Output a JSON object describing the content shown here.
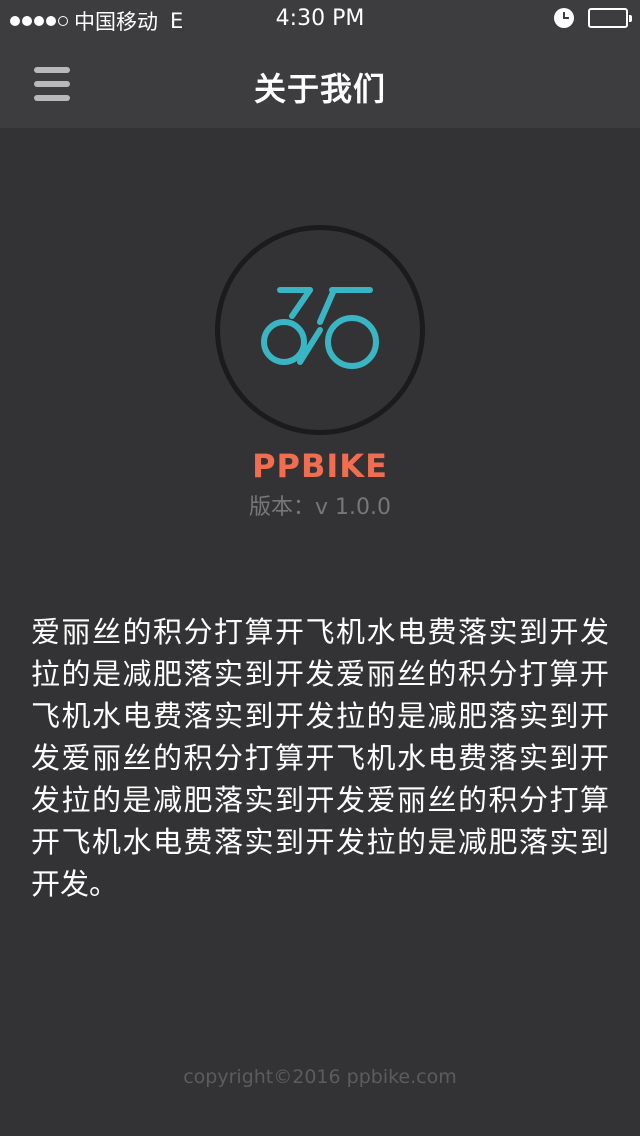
{
  "status_bar": {
    "carrier": "中国移动",
    "network": "E",
    "time": "4:30 PM",
    "signal_strength": "4/5",
    "alarm_icon": "clock-icon",
    "battery_icon": "battery-full-icon"
  },
  "nav": {
    "title": "关于我们",
    "menu_icon": "hamburger-menu-icon"
  },
  "app": {
    "logo_icon": "bicycle-logo-icon",
    "name": "PPBIKE",
    "version_label": "版本：",
    "version_value": "v 1.0.0"
  },
  "description": "爱丽丝的积分打算开飞机水电费落实到开发拉的是减肥落实到开发爱丽丝的积分打算开飞机水电费落实到开发拉的是减肥落实到开发爱丽丝的积分打算开飞机水电费落实到开发拉的是减肥落实到开发爱丽丝的积分打算开飞机水电费落实到开发拉的是减肥落实到开发。",
  "footer": {
    "copyright": "copyright©2016 ppbike.com"
  },
  "colors": {
    "background": "#333335",
    "bar_background": "#3d3d40",
    "brand": "#f26d4f",
    "logo_stroke": "#3ab5c4",
    "muted_text": "#77777a"
  }
}
